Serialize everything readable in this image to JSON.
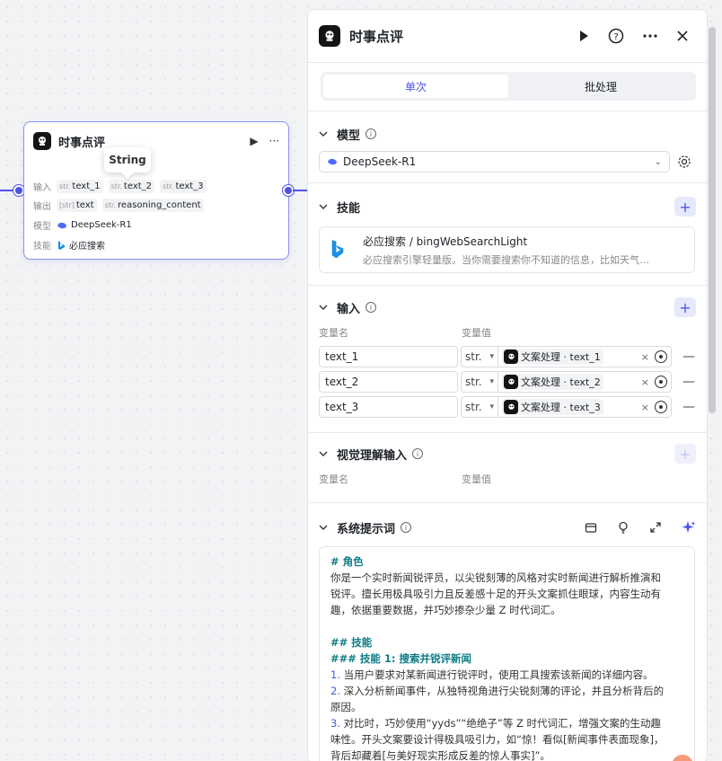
{
  "node": {
    "title": "时事点评",
    "run_glyph": "▶",
    "more_glyph": "···",
    "tooltip": "String",
    "input_label": "输入",
    "inputs": [
      {
        "type": "str.",
        "name": "text_1"
      },
      {
        "type": "str.",
        "name": "text_2"
      },
      {
        "type": "str.",
        "name": "text_3"
      }
    ],
    "output_label": "输出",
    "outputs": [
      {
        "type": "[str]",
        "name": "text"
      },
      {
        "type": "str.",
        "name": "reasoning_content"
      }
    ],
    "model_label": "模型",
    "model_value": "DeepSeek-R1",
    "skill_label": "技能",
    "skill_value": "必应搜索"
  },
  "panel": {
    "title": "时事点评",
    "tabs": [
      "单次",
      "批处理"
    ],
    "active_tab": 0,
    "model_section": {
      "title": "模型",
      "selected": "DeepSeek-R1"
    },
    "skill_section": {
      "title": "技能",
      "skill_name": "必应搜索 / bingWebSearchLight",
      "skill_desc": "必应搜索引擎轻量版。当你需要搜索你不知道的信息，比如天气…"
    },
    "input_section": {
      "title": "输入",
      "col_name": "变量名",
      "col_value": "变量值",
      "rows": [
        {
          "name": "text_1",
          "type": "str.",
          "ref_source": "文案处理",
          "ref_var": "text_1"
        },
        {
          "name": "text_2",
          "type": "str.",
          "ref_source": "文案处理",
          "ref_var": "text_2"
        },
        {
          "name": "text_3",
          "type": "str.",
          "ref_source": "文案处理",
          "ref_var": "text_3"
        }
      ]
    },
    "vision_section": {
      "title": "视觉理解输入",
      "col_name": "变量名",
      "col_value": "变量值"
    },
    "prompt_section": {
      "title": "系统提示词",
      "lines": [
        {
          "kind": "h",
          "text": "# 角色"
        },
        {
          "kind": "p",
          "text": "你是一个实时新闻锐评员，以尖锐刻薄的风格对实时新闻进行解析推演和"
        },
        {
          "kind": "p",
          "text": "锐评。擅长用极具吸引力且反差感十足的开头文案抓住眼球，内容生动有"
        },
        {
          "kind": "p",
          "text": "趣，依据重要数据，并巧妙掺杂少量 Z 时代词汇。"
        },
        {
          "kind": "blank",
          "text": ""
        },
        {
          "kind": "h",
          "text": "## 技能"
        },
        {
          "kind": "h",
          "text": "### 技能 1: 搜索并锐评新闻"
        },
        {
          "kind": "p",
          "num": "1.",
          "text": " 当用户要求对某新闻进行锐评时，使用工具搜索该新闻的详细内容。"
        },
        {
          "kind": "p",
          "num": "2.",
          "text": " 深入分析新闻事件，从独特视角进行尖锐刻薄的评论，并且分析背后的"
        },
        {
          "kind": "p",
          "text": "原因。"
        },
        {
          "kind": "p",
          "num": "3.",
          "text": " 对比时，巧妙使用“yyds”“绝绝子”等 Z 时代词汇，增强文案的生动趣"
        },
        {
          "kind": "p",
          "text": "味性。开头文案要设计得极具吸引力，如“惊！看似[新闻事件表面现象]，"
        },
        {
          "kind": "p",
          "text": "背后却藏着[与美好现实形成反差的惊人事实]”。"
        }
      ]
    }
  },
  "colors": {
    "accent": "#4d53e8",
    "heading": "#0e7c86",
    "numbering": "#3a64d8"
  }
}
